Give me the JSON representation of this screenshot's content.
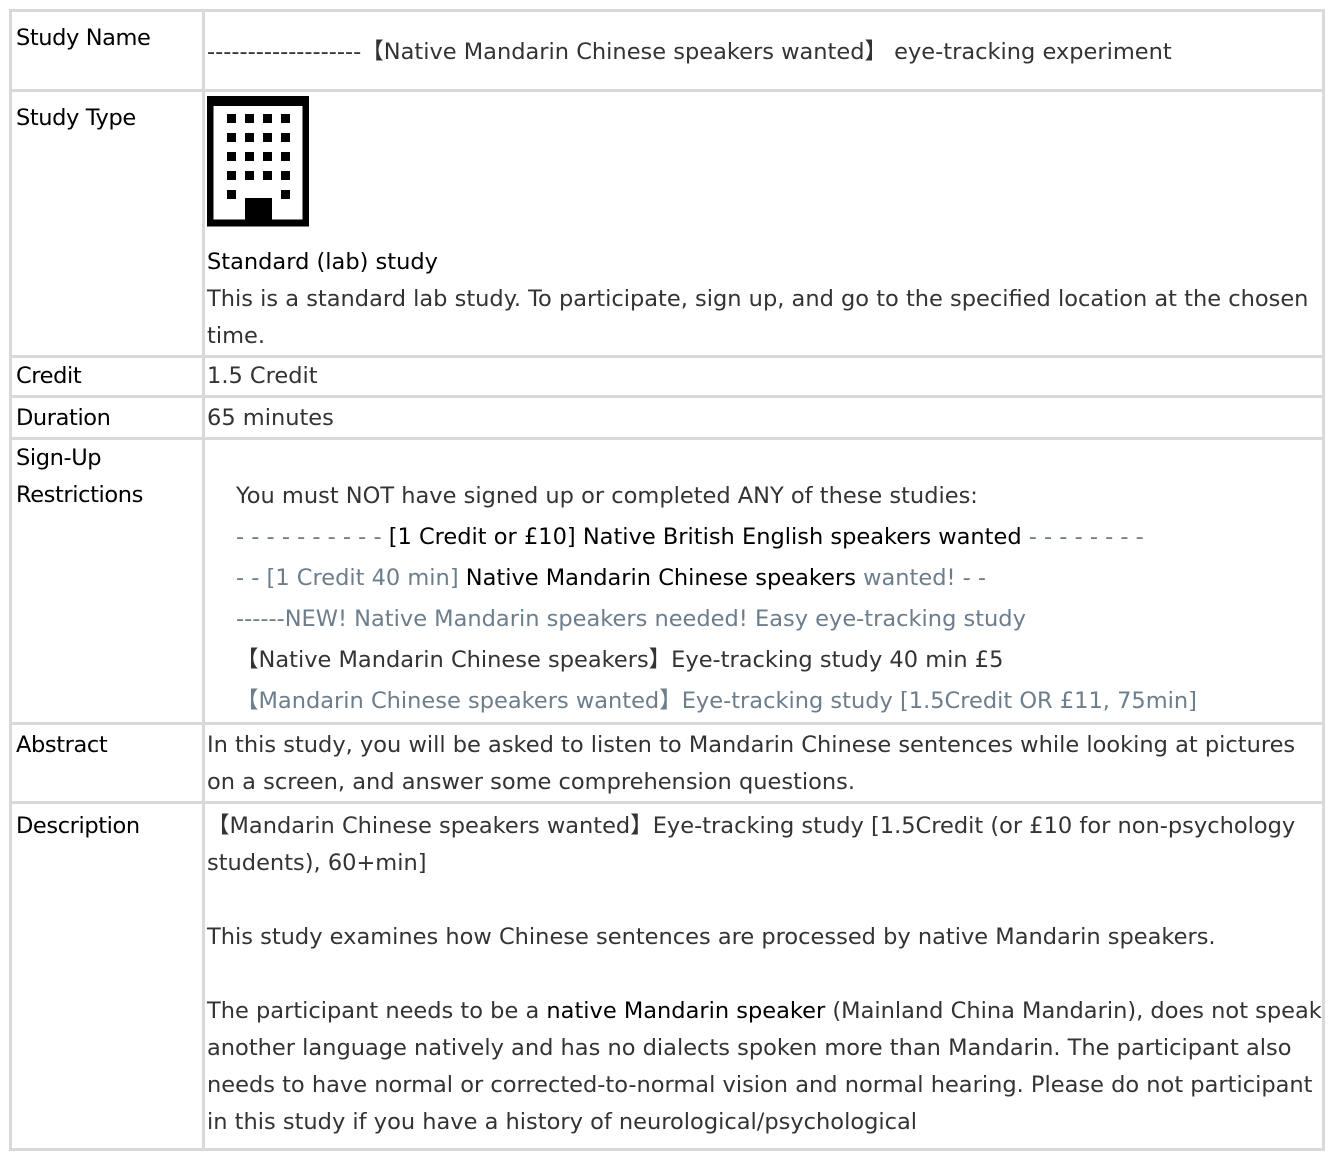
{
  "labels": {
    "study_name": "Study Name",
    "study_type": "Study Type",
    "credit": "Credit",
    "duration": "Duration",
    "signup_1": "Sign-Up",
    "signup_2": "Restrictions",
    "abstract": "Abstract",
    "description": "Description"
  },
  "study_name": "-------------------【Native Mandarin Chinese speakers wanted】 eye-tracking experiment",
  "study_type": {
    "icon": "building-icon",
    "name": "Standard (lab) study",
    "text": "This is a standard lab study. To participate, sign up, and go to the specified location at the chosen time."
  },
  "credit": "1.5 Credit",
  "duration": "65 minutes",
  "restrictions": {
    "intro": "You must NOT have signed up or completed ANY of these studies:",
    "s1_pre": "- - - - - - - - - - ",
    "s1_main": "[1 Credit or £10] Native British English speakers wanted",
    "s1_post": " - - - - - - - -",
    "s2_pre": "- - [1 Credit 40 min] ",
    "s2_main": "Native Mandarin Chinese speakers",
    "s2_post": " wanted! - -",
    "s3": "------NEW! Native Mandarin speakers needed! Easy eye-tracking study",
    "s4": "【Native Mandarin Chinese speakers】Eye-tracking study 40 min £5",
    "s5": "【Mandarin Chinese speakers wanted】Eye-tracking study [1.5Credit OR £11, 75min]"
  },
  "abstract": "In this study, you will be asked to listen to Mandarin Chinese sentences while looking at pictures on a screen, and answer some comprehension questions.",
  "description": {
    "p1": "【Mandarin Chinese speakers wanted】Eye-tracking study [1.5Credit (or £10 for non-psychology students), 60+min]",
    "p2": "This study examines how Chinese sentences are processed by native Mandarin speakers.",
    "p3_pre": "The participant needs to be a ",
    "p3_bold": "native Mandarin speaker",
    "p3_post": " (Mainland China Mandarin), does not speak another language natively and has no dialects spoken more than Mandarin. The participant also needs to have normal or corrected-to-normal vision and normal hearing. Please do not participant in this study if you have a history of neurological/psychological"
  }
}
